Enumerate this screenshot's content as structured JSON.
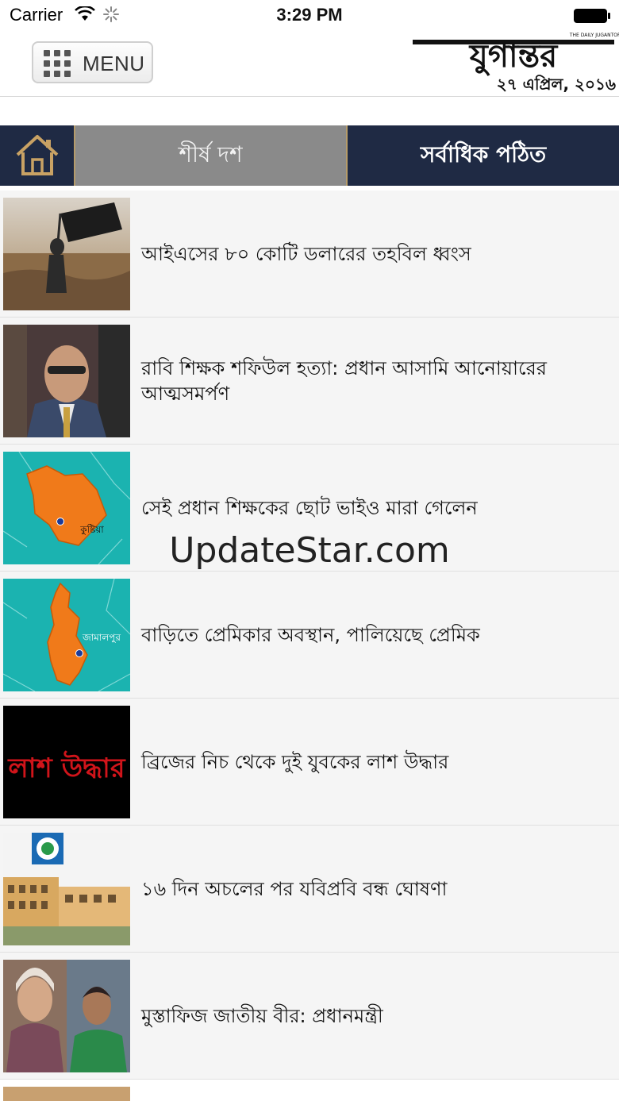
{
  "status_bar": {
    "carrier": "Carrier",
    "time": "3:29 PM"
  },
  "header": {
    "menu_label": "MENU",
    "logo_text": "যুগান্তর",
    "logo_tagline": "THE DAILY JUGANTOR",
    "date": "২৭ এপ্রিল, ২০১৬"
  },
  "tabs": {
    "home_icon": "home-icon",
    "top_ten": "শীর্ষ দশ",
    "most_read": "সর্বাধিক পঠিত"
  },
  "articles": [
    {
      "title": "আইএসের ৮০ কোটি ডলারের তহবিল ধ্বংস"
    },
    {
      "title": "রাবি শিক্ষক শফিউল হত্যা: প্রধান আসামি আনোয়ারের আত্মসমর্পণ"
    },
    {
      "title": "সেই প্রধান শিক্ষকের ছোট ভাইও মারা গেলেন",
      "map_label": "কুষ্টিয়া"
    },
    {
      "title": "বাড়িতে প্রেমিকার অবস্থান, পালিয়েছে প্রেমিক",
      "map_label": "জামালপুর"
    },
    {
      "title": "ব্রিজের নিচ থেকে দুই যুবকের লাশ উদ্ধার",
      "thumb_text": "লাশ উদ্ধার"
    },
    {
      "title": "১৬ দিন অচলের পর যবিপ্রবি বন্ধ ঘোষণা"
    },
    {
      "title": "মুস্তাফিজ জাতীয় বীর: প্রধানমন্ত্রী"
    }
  ],
  "watermark": "UpdateStar.com",
  "colors": {
    "navy": "#1f2a44",
    "gray_tab": "#8a8a8a",
    "accent_gold": "#b59b6a",
    "map_teal": "#1bb3b0",
    "map_orange": "#f07a1a"
  }
}
